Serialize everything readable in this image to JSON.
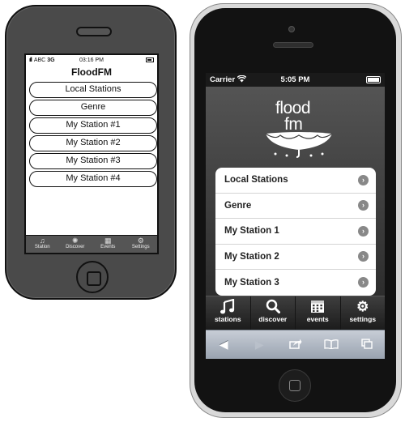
{
  "mockup": {
    "status": {
      "signal_icon": "signal-bars-icon",
      "carrier": "ABC",
      "network": "3G",
      "time": "03:16 PM"
    },
    "title": "FloodFM",
    "buttons": [
      {
        "label": "Local Stations"
      },
      {
        "label": "Genre"
      },
      {
        "label": "My Station #1"
      },
      {
        "label": "My Station #2"
      },
      {
        "label": "My Station #3"
      },
      {
        "label": "My Station #4"
      }
    ],
    "tabs": [
      {
        "label": "Station",
        "icon": "note-icon"
      },
      {
        "label": "Discover",
        "icon": "loader-icon"
      },
      {
        "label": "Events",
        "icon": "calendar-icon"
      },
      {
        "label": "Settings",
        "icon": "gear-icon"
      }
    ]
  },
  "iphone": {
    "status": {
      "carrier": "Carrier",
      "time": "5:05 PM"
    },
    "logo": {
      "line1": "flood",
      "line2": "fm",
      "icon": "umbrella-icon"
    },
    "menu": [
      {
        "label": "Local Stations"
      },
      {
        "label": "Genre"
      },
      {
        "label": "My Station 1"
      },
      {
        "label": "My Station 2"
      },
      {
        "label": "My Station 3"
      }
    ],
    "tabs": [
      {
        "label": "stations",
        "icon": "music-note-icon"
      },
      {
        "label": "discover",
        "icon": "search-icon"
      },
      {
        "label": "events",
        "icon": "calendar-icon"
      },
      {
        "label": "settings",
        "icon": "gear-icon"
      }
    ],
    "safari": {
      "back": "◀",
      "forward": "▶"
    }
  }
}
